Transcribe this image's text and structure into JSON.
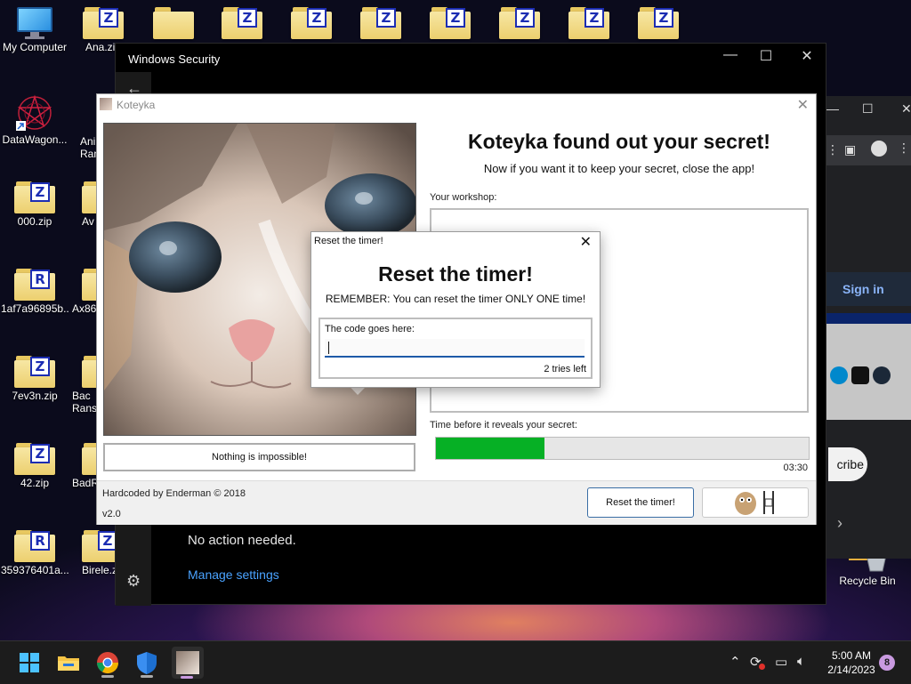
{
  "desktop": {
    "icons": [
      {
        "label": "My Computer"
      },
      {
        "label": "Ana.zi"
      },
      {
        "label": "DataWagon..."
      },
      {
        "label": "Ani Rans"
      },
      {
        "label": "000.zip"
      },
      {
        "label": "Av"
      },
      {
        "label": "1af7a96895b..."
      },
      {
        "label": "Ax86"
      },
      {
        "label": "7ev3n.zip"
      },
      {
        "label": "Bac Rans"
      },
      {
        "label": "42.zip"
      },
      {
        "label": "BadR"
      },
      {
        "label": "359376401a..."
      },
      {
        "label": "Birele.z"
      },
      {
        "label": "Recycle Bin"
      }
    ],
    "badges": {
      "zip": "Z",
      "rar": "R"
    }
  },
  "windows_security": {
    "title": "Windows Security",
    "no_action": "No action needed.",
    "manage_settings": "Manage settings"
  },
  "browser": {
    "sign_in": "Sign in",
    "subscribe": "cribe"
  },
  "koteyka": {
    "title": "Koteyka",
    "headline": "Koteyka found out your secret!",
    "subtitle": "Now if you want it to keep your secret, close the app!",
    "workshop_label": "Your workshop:",
    "time_label": "Time before it reveals your secret:",
    "progress": 0.29,
    "time_remaining": "03:30",
    "nothing_button": "Nothing is impossible!",
    "credit": "Hardcoded by Enderman © 2018",
    "version": "v2.0",
    "reset_button": "Reset the timer!",
    "accent_progress": "#06b025"
  },
  "reset_dialog": {
    "title": "Reset the timer!",
    "heading": "Reset the timer!",
    "reminder": "REMEMBER: You can reset the timer ONLY ONE time!",
    "code_label": "The code goes here:",
    "code_value": "",
    "tries": "2 tries left"
  },
  "taskbar": {
    "time": "5:00 AM",
    "date": "2/14/2023",
    "notification_count": "8",
    "pinned": [
      "start-icon",
      "file-explorer-icon",
      "chrome-icon",
      "defender-icon",
      "koteyka-icon"
    ]
  }
}
